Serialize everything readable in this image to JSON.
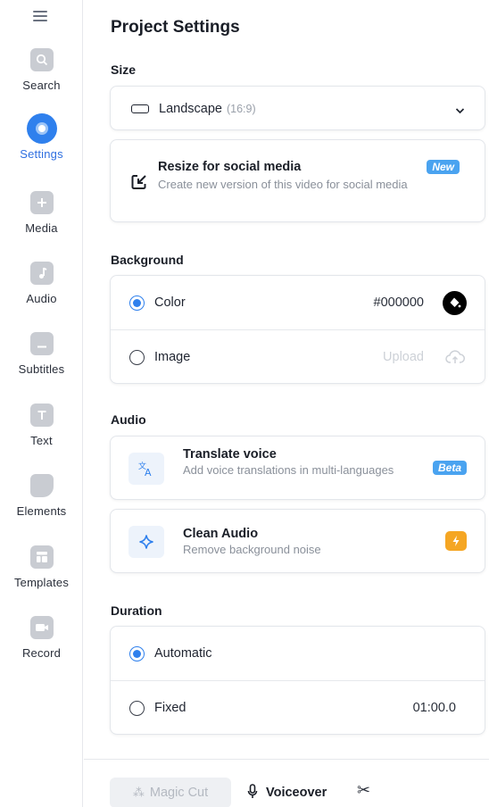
{
  "sidebar": {
    "items": [
      {
        "label": "Search",
        "icon": "search-icon"
      },
      {
        "label": "Settings",
        "icon": "settings-icon",
        "active": true
      },
      {
        "label": "Media",
        "icon": "plus-icon"
      },
      {
        "label": "Audio",
        "icon": "music-note-icon"
      },
      {
        "label": "Subtitles",
        "icon": "subtitles-icon"
      },
      {
        "label": "Text",
        "icon": "text-icon"
      },
      {
        "label": "Elements",
        "icon": "elements-icon"
      },
      {
        "label": "Templates",
        "icon": "templates-icon"
      },
      {
        "label": "Record",
        "icon": "camera-icon"
      }
    ]
  },
  "page": {
    "title": "Project Settings"
  },
  "size": {
    "label": "Size",
    "select_value": "Landscape",
    "select_ratio": "(16:9)",
    "resize_title": "Resize for social media",
    "resize_desc": "Create new version of this video for social media",
    "resize_badge": "New"
  },
  "background": {
    "label": "Background",
    "color_option": "Color",
    "color_value": "#000000",
    "image_option": "Image",
    "upload_label": "Upload"
  },
  "audio": {
    "label": "Audio",
    "translate_title": "Translate voice",
    "translate_desc": "Add voice translations in multi-languages",
    "translate_badge": "Beta",
    "clean_title": "Clean Audio",
    "clean_desc": "Remove background noise"
  },
  "duration": {
    "label": "Duration",
    "auto_option": "Automatic",
    "fixed_option": "Fixed",
    "fixed_value": "01:00.0"
  },
  "bottom": {
    "magic_cut": "Magic Cut",
    "voiceover": "Voiceover"
  },
  "colors": {
    "accent": "#2f80ed",
    "badge_blue": "#4aa3f0",
    "badge_orange": "#f5a623"
  }
}
